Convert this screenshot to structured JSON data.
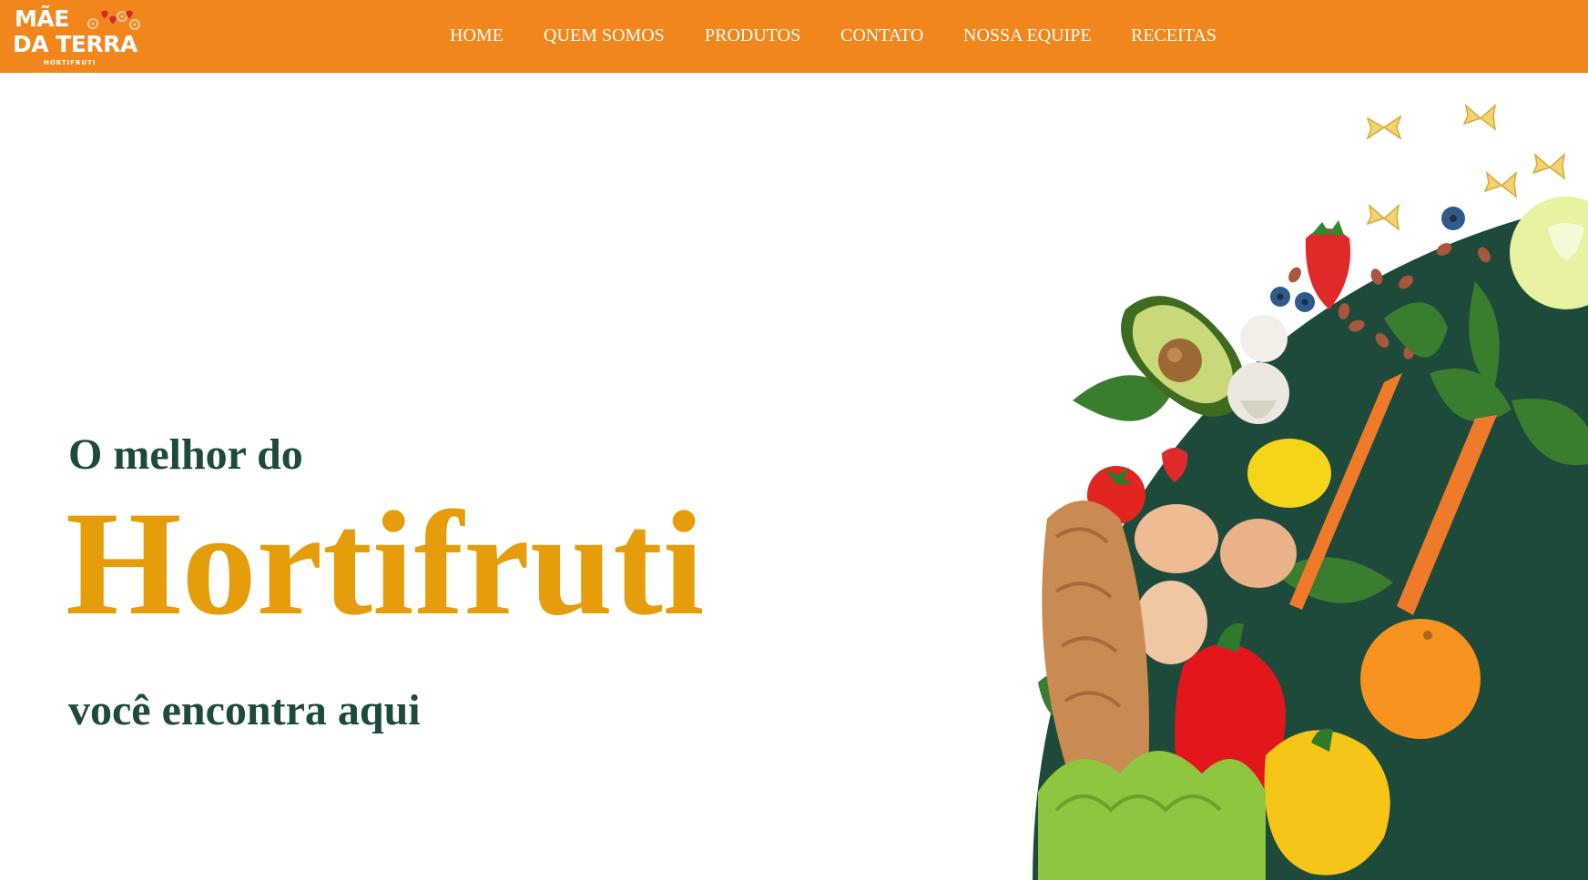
{
  "brand": {
    "name_line1": "MÃE",
    "name_line2": "DA TERRA",
    "tagline": "HORTIFRUTI"
  },
  "nav": {
    "items": [
      {
        "label": "HOME"
      },
      {
        "label": "QUEM SOMOS"
      },
      {
        "label": "PRODUTOS"
      },
      {
        "label": "CONTATO"
      },
      {
        "label": "NOSSA EQUIPE"
      },
      {
        "label": "RECEITAS"
      }
    ]
  },
  "hero": {
    "line1": "O melhor do",
    "headline": "Hortifruti",
    "line3": "você encontra aqui"
  },
  "colors": {
    "header_bg": "#f0861c",
    "headline": "#e59d0b",
    "dark_green": "#1e4a3b"
  }
}
